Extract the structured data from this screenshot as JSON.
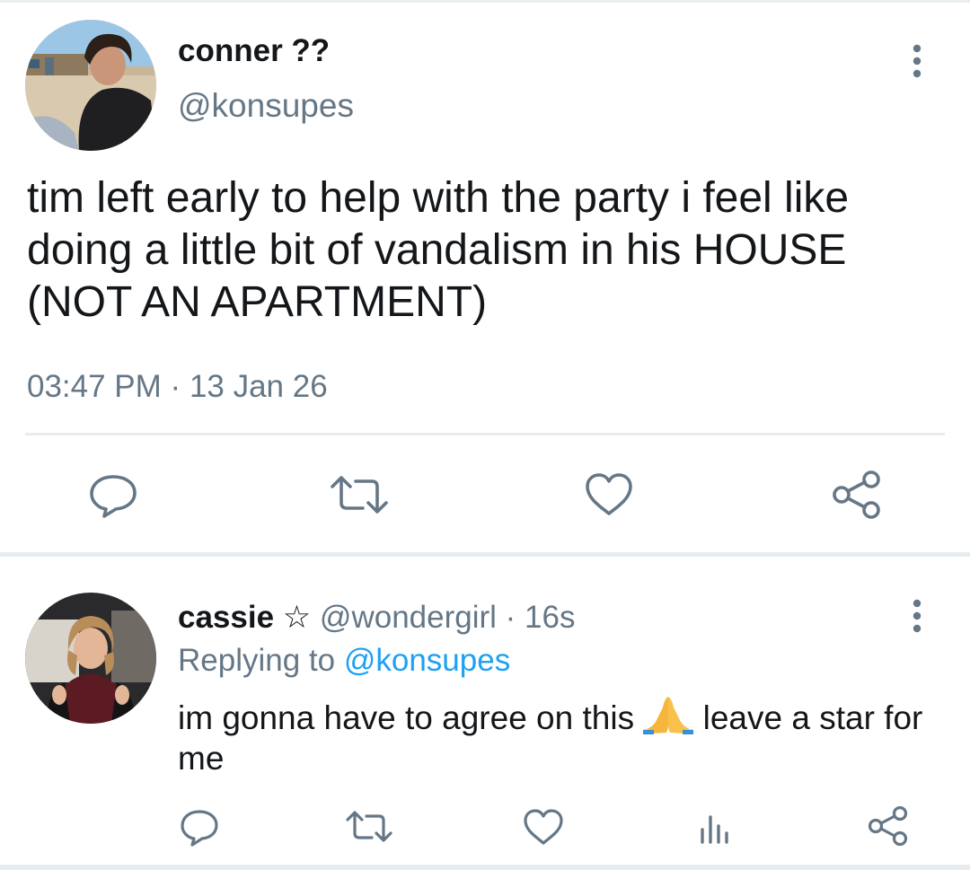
{
  "main_tweet": {
    "display_name": "conner ??",
    "handle": "@konsupes",
    "text": "tim left early to help with the party i feel like doing a little bit of vandalism in his HOUSE (NOT AN APARTMENT)",
    "time": "03:47 PM",
    "separator": "·",
    "date": "13 Jan 26"
  },
  "reply": {
    "display_name": "cassie",
    "star": "☆",
    "handle": "@wondergirl",
    "separator": "·",
    "age": "16s",
    "replying_label": "Replying to",
    "replying_to": "@konsupes",
    "text_before_emoji": "im gonna have to agree on this ",
    "text_after_emoji": " leave a star for me"
  },
  "icons": {
    "main_actions": [
      "reply-icon",
      "retweet-icon",
      "like-icon",
      "share-icon"
    ],
    "reply_actions": [
      "reply-icon",
      "retweet-icon",
      "like-icon",
      "stats-icon",
      "share-icon"
    ],
    "more": "more-vertical-icon",
    "emoji": "folded-hands-emoji"
  },
  "colors": {
    "text_primary": "#14171a",
    "text_secondary": "#657786",
    "link": "#1da1f2",
    "icon": "#657786",
    "divider": "#e6ecf0"
  }
}
